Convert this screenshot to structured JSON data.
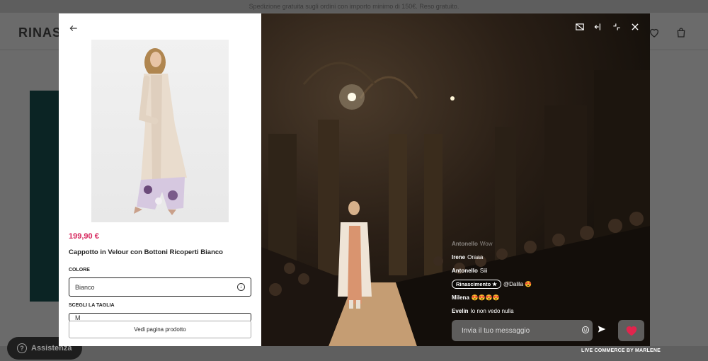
{
  "site": {
    "promo_text": "Spedizione gratuita sugli ordini con importo minimo di 150€. Reso gratuito.",
    "logo_text": "RINAS",
    "assist_label": "Assistenza"
  },
  "panel": {
    "price": "199,90 €",
    "title": "Cappotto in Velour con Bottoni Ricoperti Bianco",
    "color_label": "COLORE",
    "color_value": "Bianco",
    "size_label": "SCEGLI LA TAGLIA",
    "size_value": "M",
    "view_button": "Vedi pagina prodotto"
  },
  "chat": {
    "messages": [
      {
        "user": "Antonello",
        "text": "Wow"
      },
      {
        "user": "Irene",
        "text": "Oraaa"
      },
      {
        "user": "Antonello",
        "text": "Siii"
      },
      {
        "user": "Rinascimento ★",
        "text": "@Dalila 😍"
      },
      {
        "user": "Milena",
        "text": "😍😍😍😍"
      },
      {
        "user": "Evelin",
        "text": "Io non vedo nulla"
      }
    ],
    "input_placeholder": "Invia il tuo messaggio"
  },
  "footer": {
    "credit_prefix": "LIVE COMMERCE BY",
    "credit_brand": "MARLENE"
  },
  "colors": {
    "price": "#d6245b",
    "heart": "#e1254d"
  }
}
